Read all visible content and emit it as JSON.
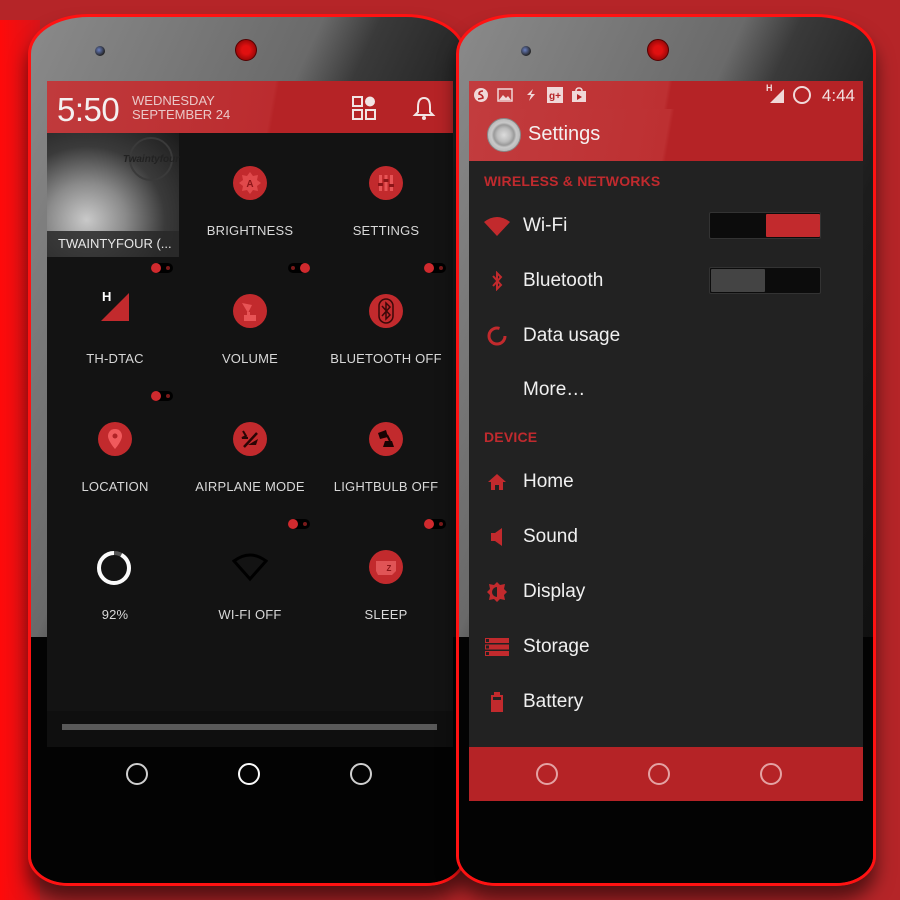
{
  "colors": {
    "accent": "#b52326",
    "accent_light": "#c22a2d",
    "background": "#131313",
    "settings_background": "#222222",
    "frame": "#ff1212"
  },
  "left_phone": {
    "header": {
      "time": "5:50",
      "day": "WEDNESDAY",
      "date": "SEPTEMBER 24",
      "icons": [
        "tiles-edit-icon",
        "notification-bell-icon"
      ]
    },
    "tiles": [
      {
        "label": "TWAINTYFOUR (...",
        "icon": "album-art",
        "stamp_text": "Twaintyfour"
      },
      {
        "label": "BRIGHTNESS",
        "icon": "brightness-auto-icon"
      },
      {
        "label": "SETTINGS",
        "icon": "settings-sliders-icon"
      },
      {
        "label": "TH-DTAC",
        "icon": "signal-h-icon",
        "toggle": "on",
        "network_type": "H"
      },
      {
        "label": "VOLUME",
        "icon": "gramophone-icon",
        "toggle": "on"
      },
      {
        "label": "BLUETOOTH OFF",
        "icon": "bluetooth-icon",
        "toggle": "on"
      },
      {
        "label": "LOCATION",
        "icon": "location-pin-icon",
        "toggle": "on"
      },
      {
        "label": "AIRPLANE MODE",
        "icon": "airplane-mode-icon"
      },
      {
        "label": "LIGHTBULB OFF",
        "icon": "lamp-icon"
      },
      {
        "label": "92%",
        "icon": "battery-ring-icon",
        "battery_percent": 92
      },
      {
        "label": "WI-FI OFF",
        "icon": "wifi-off-icon",
        "toggle": "on"
      },
      {
        "label": "SLEEP",
        "icon": "sleep-icon",
        "toggle": "on"
      }
    ],
    "brightness_slider": {
      "value_fraction": 1.0
    },
    "nav_buttons": [
      "back-button",
      "home-button",
      "recents-button"
    ]
  },
  "right_phone": {
    "status_bar": {
      "notification_icons": [
        "swiftkey-icon",
        "gallery-icon",
        "feedly-icon",
        "google-plus-icon",
        "play-store-icon"
      ],
      "network_type": "H",
      "time": "4:44"
    },
    "action_bar": {
      "title": "Settings"
    },
    "sections": [
      {
        "header": "WIRELESS & NETWORKS",
        "items": [
          {
            "label": "Wi-Fi",
            "icon": "wifi-icon",
            "switch": "on"
          },
          {
            "label": "Bluetooth",
            "icon": "bluetooth-icon",
            "switch": "off"
          },
          {
            "label": "Data usage",
            "icon": "data-usage-icon"
          },
          {
            "label": "More…",
            "icon": ""
          }
        ]
      },
      {
        "header": "DEVICE",
        "items": [
          {
            "label": "Home",
            "icon": "home-icon"
          },
          {
            "label": "Sound",
            "icon": "sound-icon"
          },
          {
            "label": "Display",
            "icon": "display-icon"
          },
          {
            "label": "Storage",
            "icon": "storage-icon"
          },
          {
            "label": "Battery",
            "icon": "battery-icon"
          }
        ]
      }
    ],
    "nav_buttons": [
      "back-button",
      "home-button",
      "recents-button"
    ]
  }
}
